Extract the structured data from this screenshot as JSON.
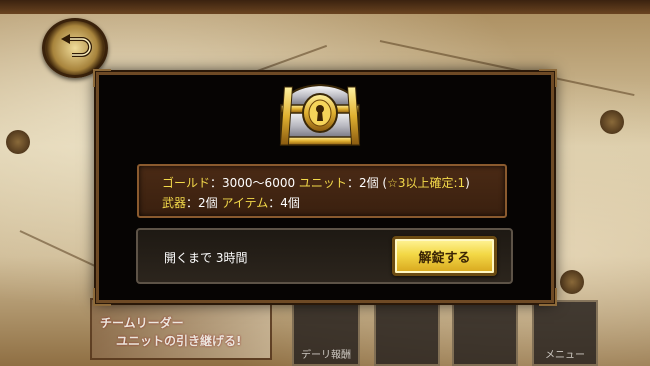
{
  "header": {
    "back_icon": "back-arrow-icon"
  },
  "chest": {
    "icon": "treasure-chest-icon"
  },
  "contents": {
    "gold_label": "ゴールド",
    "gold_value": "：3000〜6000 ",
    "unit_label": "ユニット",
    "unit_value": "：2個 (",
    "unit_note": "☆3以上確定:1",
    "unit_close": ")",
    "weapon_label": "武器",
    "weapon_value": "：2個 ",
    "item_label": "アイテム",
    "item_value": "：4個"
  },
  "timer": {
    "text": "開くまで 3時間"
  },
  "unlock_button": {
    "label": "解錠する"
  },
  "background": {
    "leader_line1": "チームリーダー",
    "leader_line2": "ユニットの引き継げる!",
    "menu_labels": [
      "デーリ報酬",
      "",
      "",
      "メニュー"
    ]
  }
}
